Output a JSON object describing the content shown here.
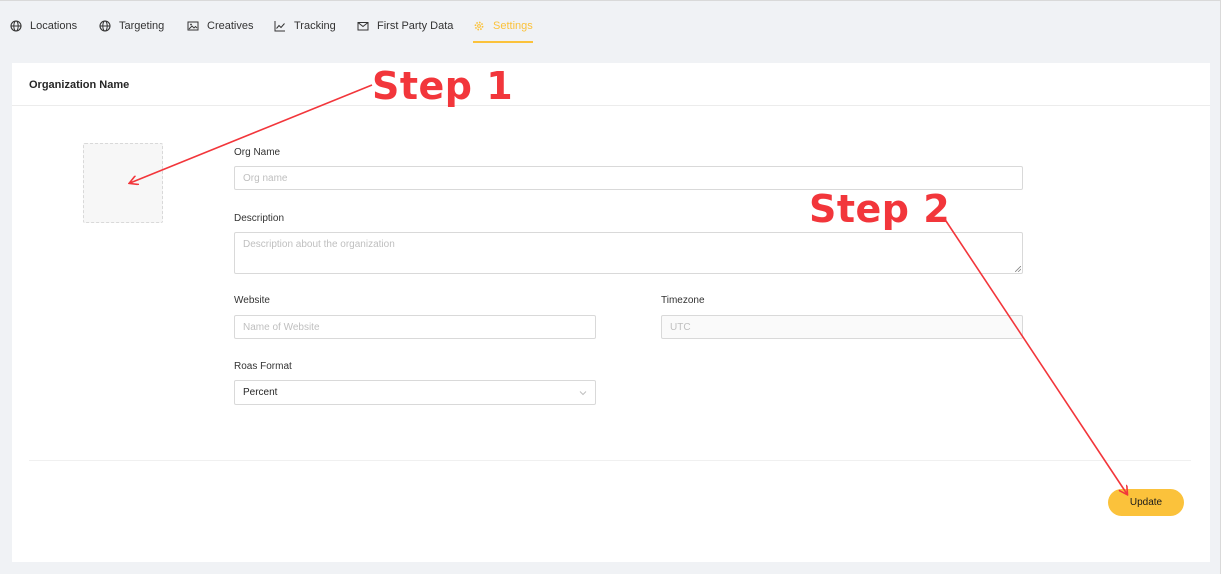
{
  "tabs": [
    {
      "label": "Locations",
      "icon": "globe-icon",
      "active": false
    },
    {
      "label": "Targeting",
      "icon": "globe-icon",
      "active": false
    },
    {
      "label": "Creatives",
      "icon": "image-icon",
      "active": false
    },
    {
      "label": "Tracking",
      "icon": "line-chart-icon",
      "active": false
    },
    {
      "label": "First Party Data",
      "icon": "mail-icon",
      "active": false
    },
    {
      "label": "Settings",
      "icon": "gear-icon",
      "active": true
    }
  ],
  "card": {
    "title": "Organization Name"
  },
  "form": {
    "org_name_label": "Org Name",
    "org_name_placeholder": "Org name",
    "description_label": "Description",
    "description_placeholder": "Description about the organization",
    "website_label": "Website",
    "website_placeholder": "Name of Website",
    "timezone_label": "Timezone",
    "timezone_placeholder": "UTC",
    "roas_label": "Roas Format",
    "roas_value": "Percent"
  },
  "actions": {
    "update_label": "Update"
  },
  "annotations": {
    "step1": "Step 1",
    "step2": "Step 2"
  },
  "colors": {
    "accent": "#fbc23b",
    "annotation": "#f2363b"
  }
}
